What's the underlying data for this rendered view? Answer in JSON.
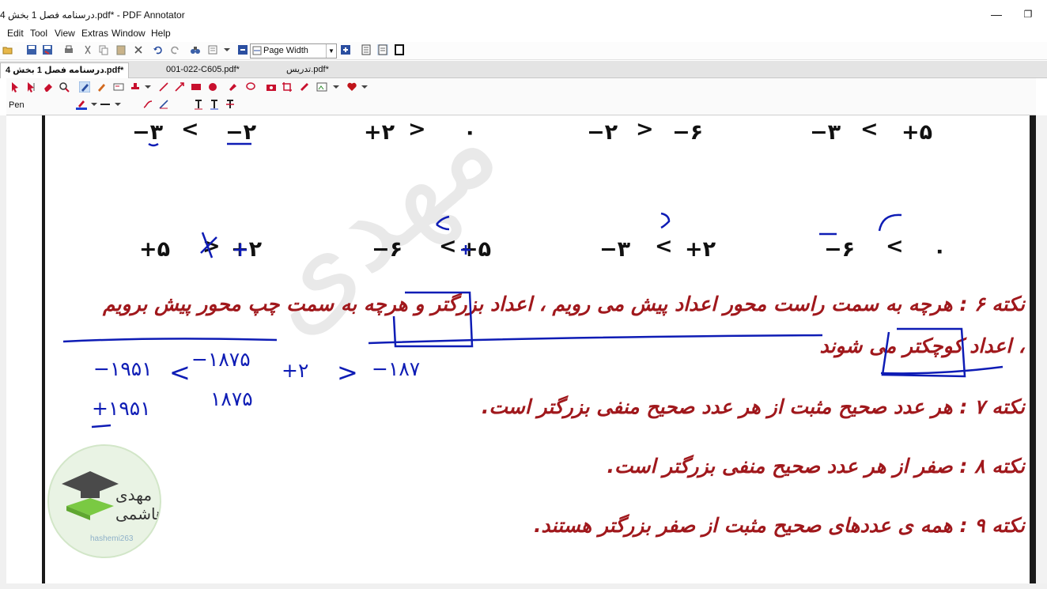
{
  "window": {
    "title": "درسنامه فصل 1 بخش 4.pdf* - PDF Annotator",
    "minimize_glyph": "—",
    "restore_glyph": "❐"
  },
  "menu": {
    "items": [
      "Edit",
      "Tool",
      "View",
      "Extras",
      "Window",
      "Help"
    ]
  },
  "toolbar": {
    "zoom_value": "Page Width"
  },
  "tabs": [
    {
      "label": "درسنامه فصل 1 بخش 4.pdf*",
      "active": true
    },
    {
      "label": "001-022-C605.pdf*",
      "active": false
    },
    {
      "label": "تدریس.pdf*",
      "active": false
    }
  ],
  "annotation_toolbar": {
    "tool_name": "Pen",
    "pen_color": "#1a3fd1",
    "heart_color": "#c0141a"
  },
  "document": {
    "row1": [
      "−۳",
      "<",
      "−۲",
      "+۲",
      ">",
      "۰",
      "−۲",
      ">",
      "−۶",
      "−۳",
      "<",
      "+۵"
    ],
    "row2": [
      "+۵",
      ">",
      "+۲",
      "−۶",
      "<",
      "+۵",
      "−۳",
      "<",
      "+۲",
      "−۶",
      "<",
      "۰"
    ],
    "notes": [
      "نکته ۶ : هرچه به سمت راست محور اعداد پیش می رویم ، اعداد بزرگتر و هرچه به سمت چپ محور پیش برویم",
      "، اعداد کوچکتر می شوند",
      "نکته ۷ : هر عدد صحیح مثبت از هر عدد صحیح منفی بزرگتر است.",
      "نکته ۸ : صفر از هر عدد صحیح منفی بزرگتر است.",
      "نکته ۹ : همه ی عددهای صحیح مثبت از صفر بزرگتر هستند."
    ],
    "handwriting": [
      "−۱۹۵۱",
      "<",
      "−۱۸۷۵",
      "+۲",
      ">",
      "−۱۸۷",
      "+۱۹۵۱",
      "۱۸۷۵"
    ],
    "logo_name": "مهدی هاشمی",
    "logo_handle": "hashemi263",
    "note_color": "#a0181c",
    "ink_color": "#0e1cb5"
  }
}
